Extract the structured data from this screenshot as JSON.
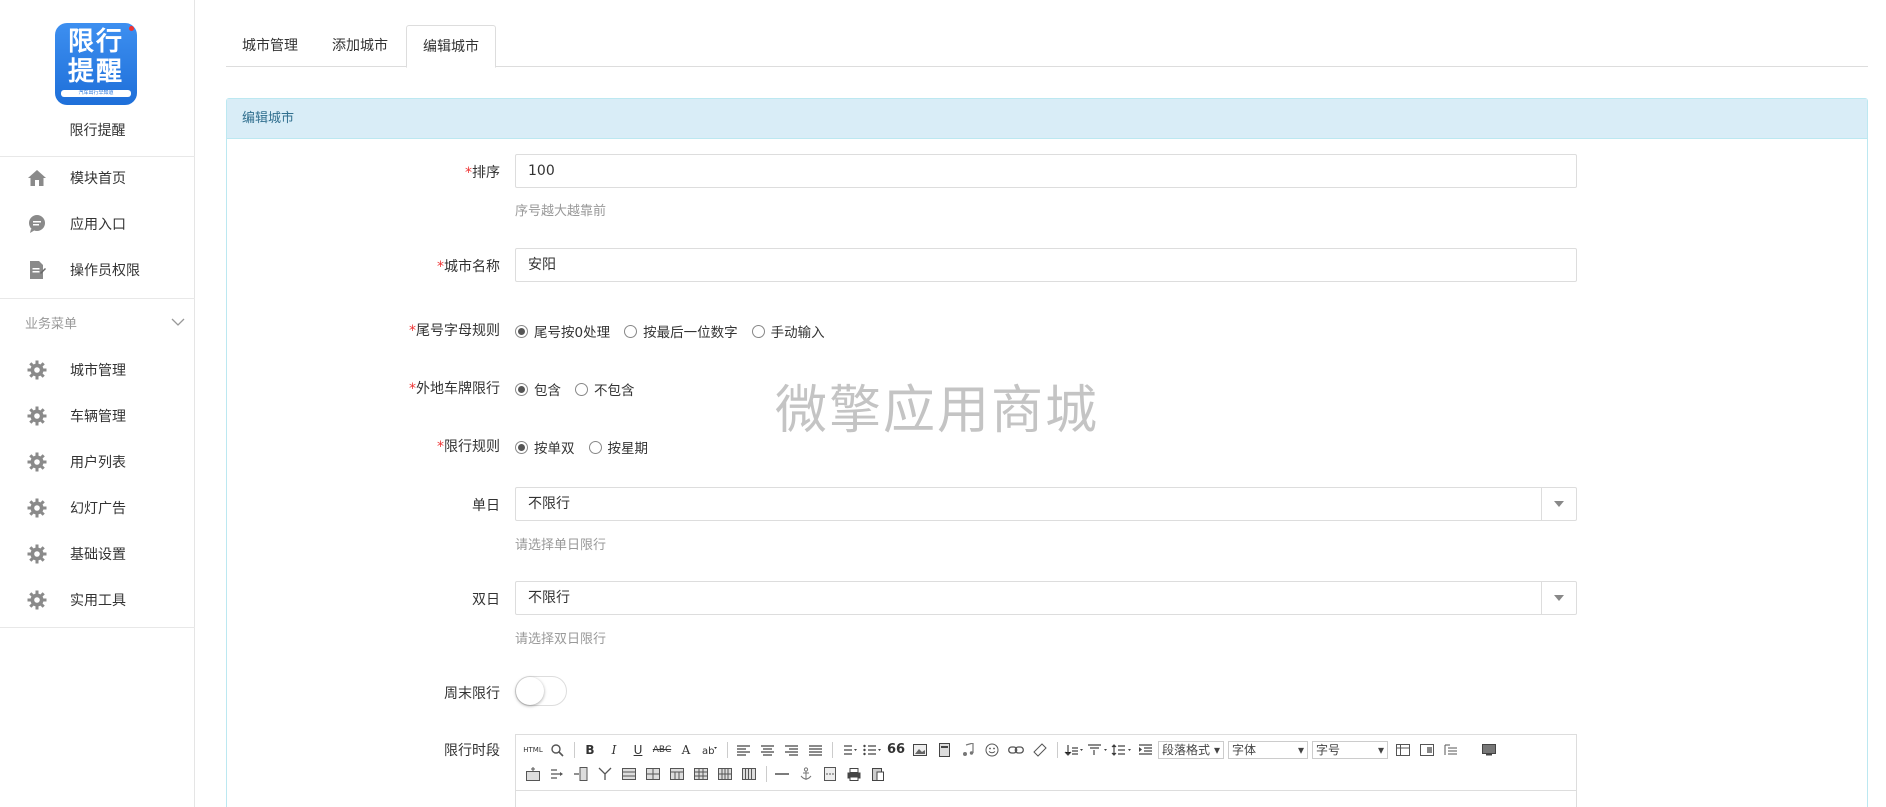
{
  "sidebar": {
    "logo": {
      "line1": "限行",
      "line2": "提醒",
      "tagline": "汽车出行早知道"
    },
    "app_name": "限行提醒",
    "top_items": [
      {
        "label": "模块首页",
        "icon": "home-icon"
      },
      {
        "label": "应用入口",
        "icon": "chat-icon"
      },
      {
        "label": "操作员权限",
        "icon": "document-edit-icon"
      }
    ],
    "group_label": "业务菜单",
    "group_items": [
      {
        "label": "城市管理",
        "icon": "gear-icon"
      },
      {
        "label": "车辆管理",
        "icon": "gear-icon"
      },
      {
        "label": "用户列表",
        "icon": "gear-icon"
      },
      {
        "label": "幻灯广告",
        "icon": "gear-icon"
      },
      {
        "label": "基础设置",
        "icon": "gear-icon"
      },
      {
        "label": "实用工具",
        "icon": "gear-icon"
      }
    ]
  },
  "tabs": [
    {
      "label": "城市管理"
    },
    {
      "label": "添加城市"
    },
    {
      "label": "编辑城市",
      "active": true
    }
  ],
  "panel_title": "编辑城市",
  "form": {
    "sort": {
      "label": "排序",
      "value": "100",
      "hint": "序号越大越靠前"
    },
    "city_name": {
      "label": "城市名称",
      "value": "安阳"
    },
    "tail_rule": {
      "label": "尾号字母规则",
      "options": [
        "尾号按0处理",
        "按最后一位数字",
        "手动输入"
      ],
      "selected": 0
    },
    "foreign_plate": {
      "label": "外地车牌限行",
      "options": [
        "包含",
        "不包含"
      ],
      "selected": 0
    },
    "limit_rule": {
      "label": "限行规则",
      "options": [
        "按单双",
        "按星期"
      ],
      "selected": 0
    },
    "single_day": {
      "label": "单日",
      "value": "不限行",
      "hint": "请选择单日限行"
    },
    "double_day": {
      "label": "双日",
      "value": "不限行",
      "hint": "请选择双日限行"
    },
    "weekend": {
      "label": "周末限行",
      "on": false
    },
    "time_period": {
      "label": "限行时段"
    }
  },
  "editor": {
    "html_label": "HTML",
    "bold": "B",
    "italic": "I",
    "underline": "U",
    "strike": "ABC",
    "font_color": "A",
    "quote": "66",
    "paragraph": "段落格式",
    "font": "字体",
    "size": "字号"
  },
  "watermark": "微擎应用商城",
  "colors": {
    "panel_head_bg": "#d9edf7",
    "panel_head_text": "#31708f",
    "required": "#ee3333",
    "logo_blue": "#1e6fd9"
  }
}
